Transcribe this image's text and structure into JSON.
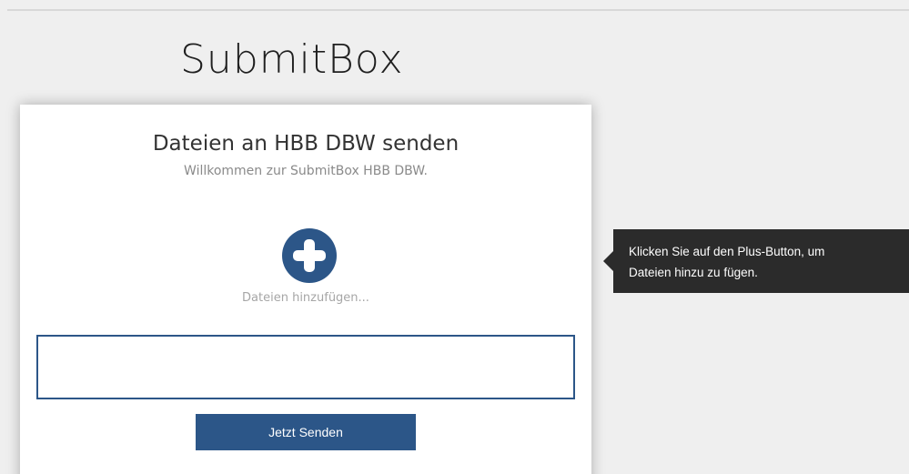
{
  "app": {
    "title": "SubmitBox"
  },
  "card": {
    "title": "Dateien an HBB DBW senden",
    "subtitle": "Willkommen zur SubmitBox HBB DBW.",
    "add_icon": "plus-circle-icon",
    "add_label": "Dateien hinzufügen...",
    "send_label": "Jetzt Senden"
  },
  "tooltip": {
    "line1": "Klicken Sie auf den Plus-Button, um",
    "line2": "Dateien hinzu zu fügen."
  },
  "colors": {
    "accent": "#2c5688",
    "background": "#efefef",
    "tooltip_bg": "#2b2b2b"
  }
}
